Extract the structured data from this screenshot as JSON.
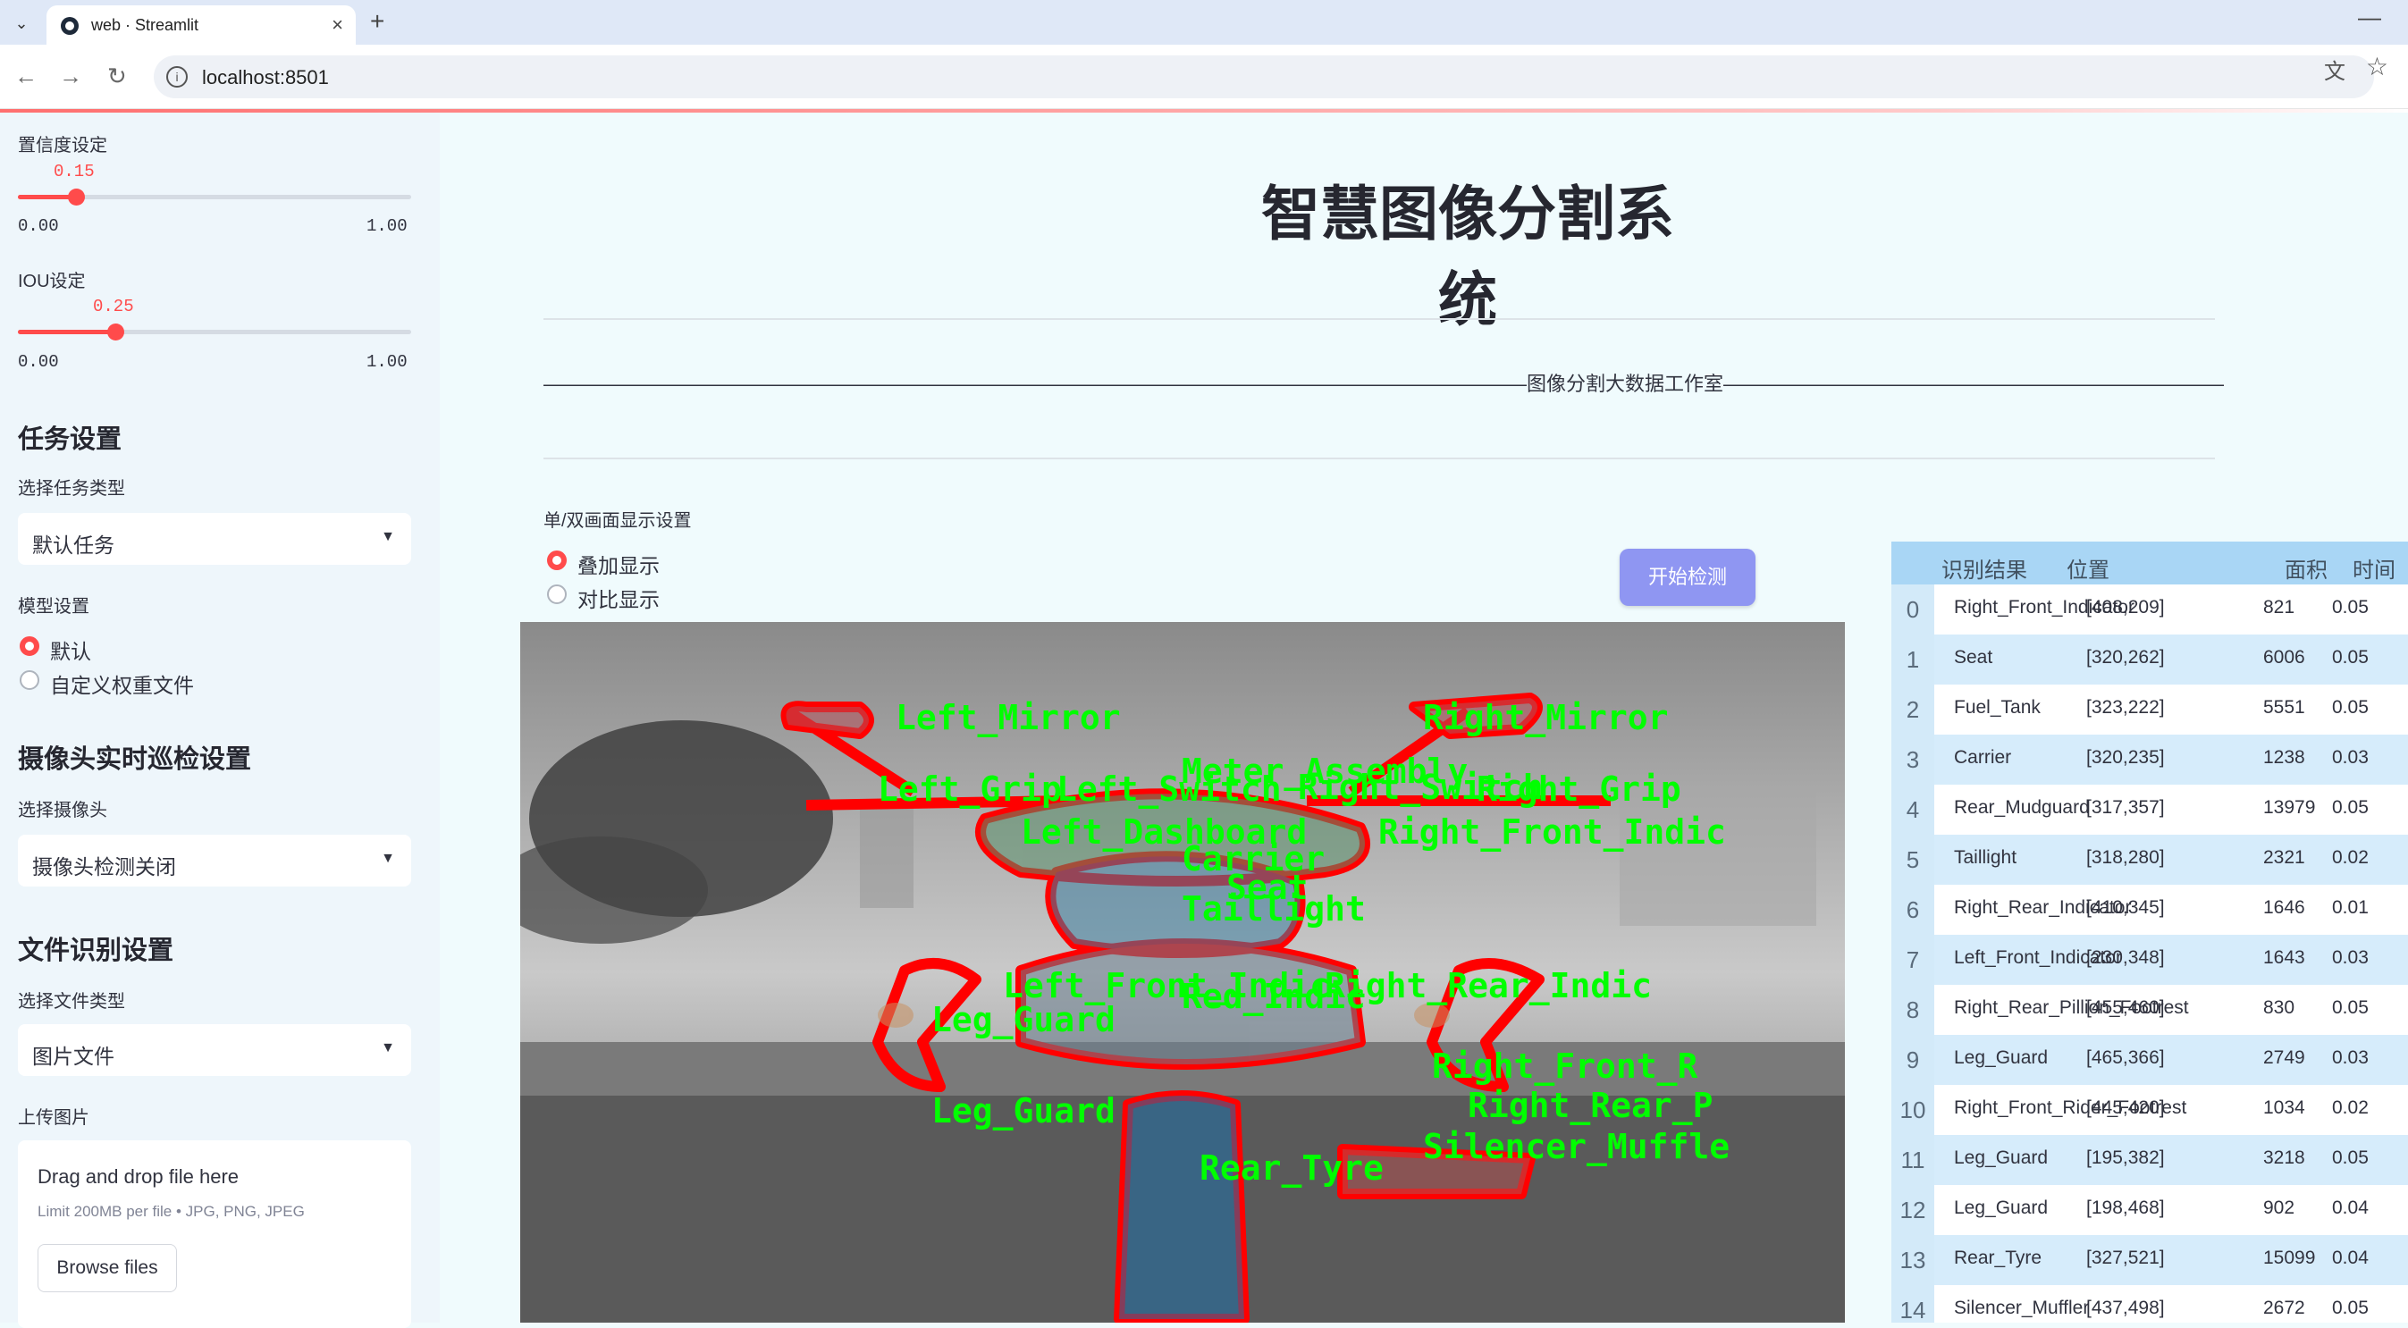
{
  "browser": {
    "tab_title": "web · Streamlit",
    "url": "localhost:8501"
  },
  "sidebar": {
    "confidence": {
      "label": "置信度设定",
      "value": "0.15",
      "value_fraction": 0.15,
      "min": "0.00",
      "max": "1.00"
    },
    "iou": {
      "label": "IOU设定",
      "value": "0.25",
      "value_fraction": 0.25,
      "min": "0.00",
      "max": "1.00"
    },
    "task_header": "任务设置",
    "task_type_label": "选择任务类型",
    "task_type_value": "默认任务",
    "model_label": "模型设置",
    "model_options": [
      "默认",
      "自定义权重文件"
    ],
    "model_selected": "默认",
    "camera_header": "摄像头实时巡检设置",
    "camera_label": "选择摄像头",
    "camera_value": "摄像头检测关闭",
    "file_header": "文件识别设置",
    "file_type_label": "选择文件类型",
    "file_type_value": "图片文件",
    "upload_label": "上传图片",
    "upload_title": "Drag and drop file here",
    "upload_limit": "Limit 200MB per file • JPG, PNG, JPEG",
    "browse_label": "Browse files"
  },
  "main": {
    "title": "智慧图像分割系统",
    "banner": "——————————————————————————————————————————————————图像分割大数据工作室——————————————————————————————————————————————————",
    "display_label": "单/双画面显示设置",
    "display_options": [
      "叠加显示",
      "对比显示"
    ],
    "display_selected": "叠加显示",
    "detect_button": "开始检测"
  },
  "image_labels": [
    "Left_Mirror",
    "Right_Mirror",
    "Meter_Assembly",
    "Left_Grip",
    "Left_Switch",
    "Right_Switch",
    "Right_Grip",
    "Left_Dashboard",
    "Right_Front_Indic",
    "Carrier",
    "Seat",
    "Taillight",
    "Left_Front_Indic",
    "Right_Rear_Indic",
    "Red_Indic",
    "Leg_Guard",
    "Right_Front_R",
    "Right_Rear_P",
    "Silencer_Muffle",
    "Rear_Tyre"
  ],
  "table": {
    "headers": [
      "识别结果",
      "位置",
      "面积",
      "时间"
    ],
    "rows": [
      {
        "idx": "0",
        "result": "Right_Front_Indicator",
        "pos": "[408,209]",
        "area": "821",
        "time": "0.05"
      },
      {
        "idx": "1",
        "result": "Seat",
        "pos": "[320,262]",
        "area": "6006",
        "time": "0.05"
      },
      {
        "idx": "2",
        "result": "Fuel_Tank",
        "pos": "[323,222]",
        "area": "5551",
        "time": "0.05"
      },
      {
        "idx": "3",
        "result": "Carrier",
        "pos": "[320,235]",
        "area": "1238",
        "time": "0.03"
      },
      {
        "idx": "4",
        "result": "Rear_Mudguard",
        "pos": "[317,357]",
        "area": "13979",
        "time": "0.05"
      },
      {
        "idx": "5",
        "result": "Taillight",
        "pos": "[318,280]",
        "area": "2321",
        "time": "0.02"
      },
      {
        "idx": "6",
        "result": "Right_Rear_Indicator",
        "pos": "[410,345]",
        "area": "1646",
        "time": "0.01"
      },
      {
        "idx": "7",
        "result": "Left_Front_Indicator",
        "pos": "[230,348]",
        "area": "1643",
        "time": "0.03"
      },
      {
        "idx": "8",
        "result": "Right_Rear_Pillion_Footrest",
        "pos": "[455,460]",
        "area": "830",
        "time": "0.05"
      },
      {
        "idx": "9",
        "result": "Leg_Guard",
        "pos": "[465,366]",
        "area": "2749",
        "time": "0.03"
      },
      {
        "idx": "10",
        "result": "Right_Front_Rider_Footrest",
        "pos": "[445,420]",
        "area": "1034",
        "time": "0.02"
      },
      {
        "idx": "11",
        "result": "Leg_Guard",
        "pos": "[195,382]",
        "area": "3218",
        "time": "0.05"
      },
      {
        "idx": "12",
        "result": "Leg_Guard",
        "pos": "[198,468]",
        "area": "902",
        "time": "0.04"
      },
      {
        "idx": "13",
        "result": "Rear_Tyre",
        "pos": "[327,521]",
        "area": "15099",
        "time": "0.04"
      },
      {
        "idx": "14",
        "result": "Silencer_Muffler",
        "pos": "[437,498]",
        "area": "2672",
        "time": "0.05"
      }
    ]
  },
  "colors": {
    "accent": "#ff4b4b",
    "button": "#8f96f2",
    "mask_outline": "#ff0000",
    "label_text": "#00ff00",
    "table_header": "#a9d6f5"
  }
}
